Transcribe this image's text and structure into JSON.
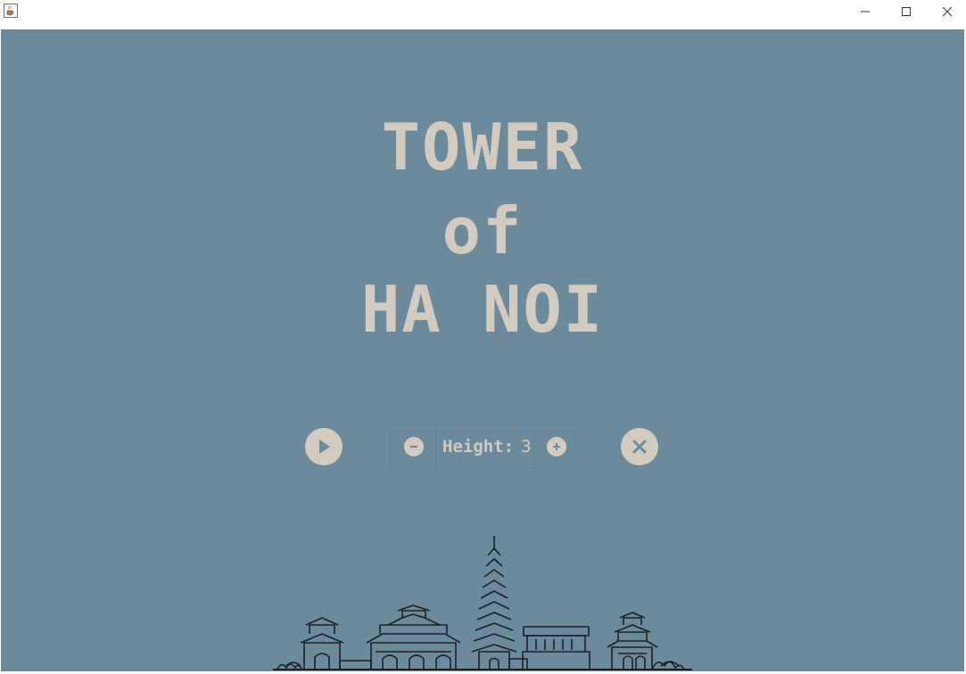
{
  "window": {
    "icon": "java-cup-icon",
    "controls": [
      "minimize-icon",
      "maximize-icon",
      "close-icon"
    ]
  },
  "title": {
    "line1": "TOWER",
    "line2": "of",
    "line3": "HA NOI"
  },
  "controls": {
    "play_icon": "play-icon",
    "exit_icon": "close-icon",
    "decrease_icon": "minus-icon",
    "increase_icon": "plus-icon",
    "height_label": "Height:",
    "height_value": "3"
  },
  "colors": {
    "background": "#6b8a9c",
    "accent": "#d3cbc0",
    "skyline": "#1c2126"
  }
}
